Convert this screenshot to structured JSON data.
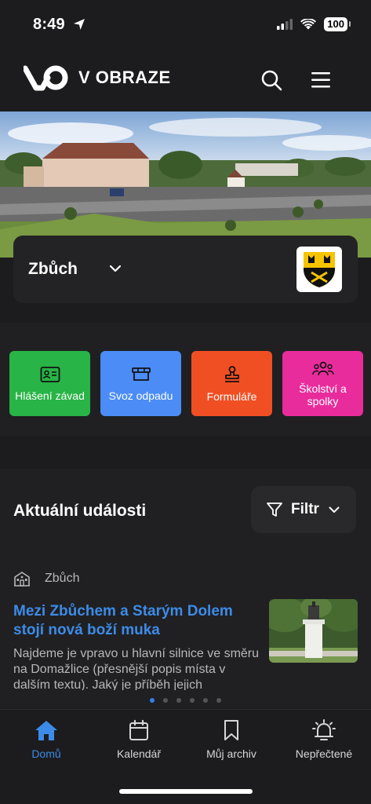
{
  "status": {
    "time": "8:49",
    "battery": "100"
  },
  "header": {
    "brand": "V OBRAZE"
  },
  "municipality": {
    "name": "Zbůch"
  },
  "quick_links": [
    {
      "label": "Hlášení závad",
      "color": "#28b446",
      "icon": "id-card-icon"
    },
    {
      "label": "Svoz odpadu",
      "color": "#4b8cf6",
      "icon": "garbage-truck-icon"
    },
    {
      "label": "Formuláře",
      "color": "#f04f23",
      "icon": "stamp-icon"
    },
    {
      "label": "Školství a spolky",
      "color": "#e92c9c",
      "icon": "people-group-icon"
    }
  ],
  "events": {
    "title": "Aktuální události",
    "filter_label": "Filtr",
    "article": {
      "category": "Zbůch",
      "title": "Mezi Zbůchem a Starým Dolem stojí nová boží muka",
      "excerpt": "Najdeme je vpravo u hlavní silnice ve směru na Domažlice (přesnější popis místa v dalším textu). Jaký je příběh jejich"
    },
    "pager": {
      "count": 6,
      "active": 1
    }
  },
  "tabs": [
    {
      "label": "Domů",
      "active": true
    },
    {
      "label": "Kalendář",
      "active": false
    },
    {
      "label": "Můj archiv",
      "active": false
    },
    {
      "label": "Nepřečtené",
      "active": false
    }
  ],
  "colors": {
    "accent": "#3d8be8",
    "background": "#1c1c1e"
  }
}
